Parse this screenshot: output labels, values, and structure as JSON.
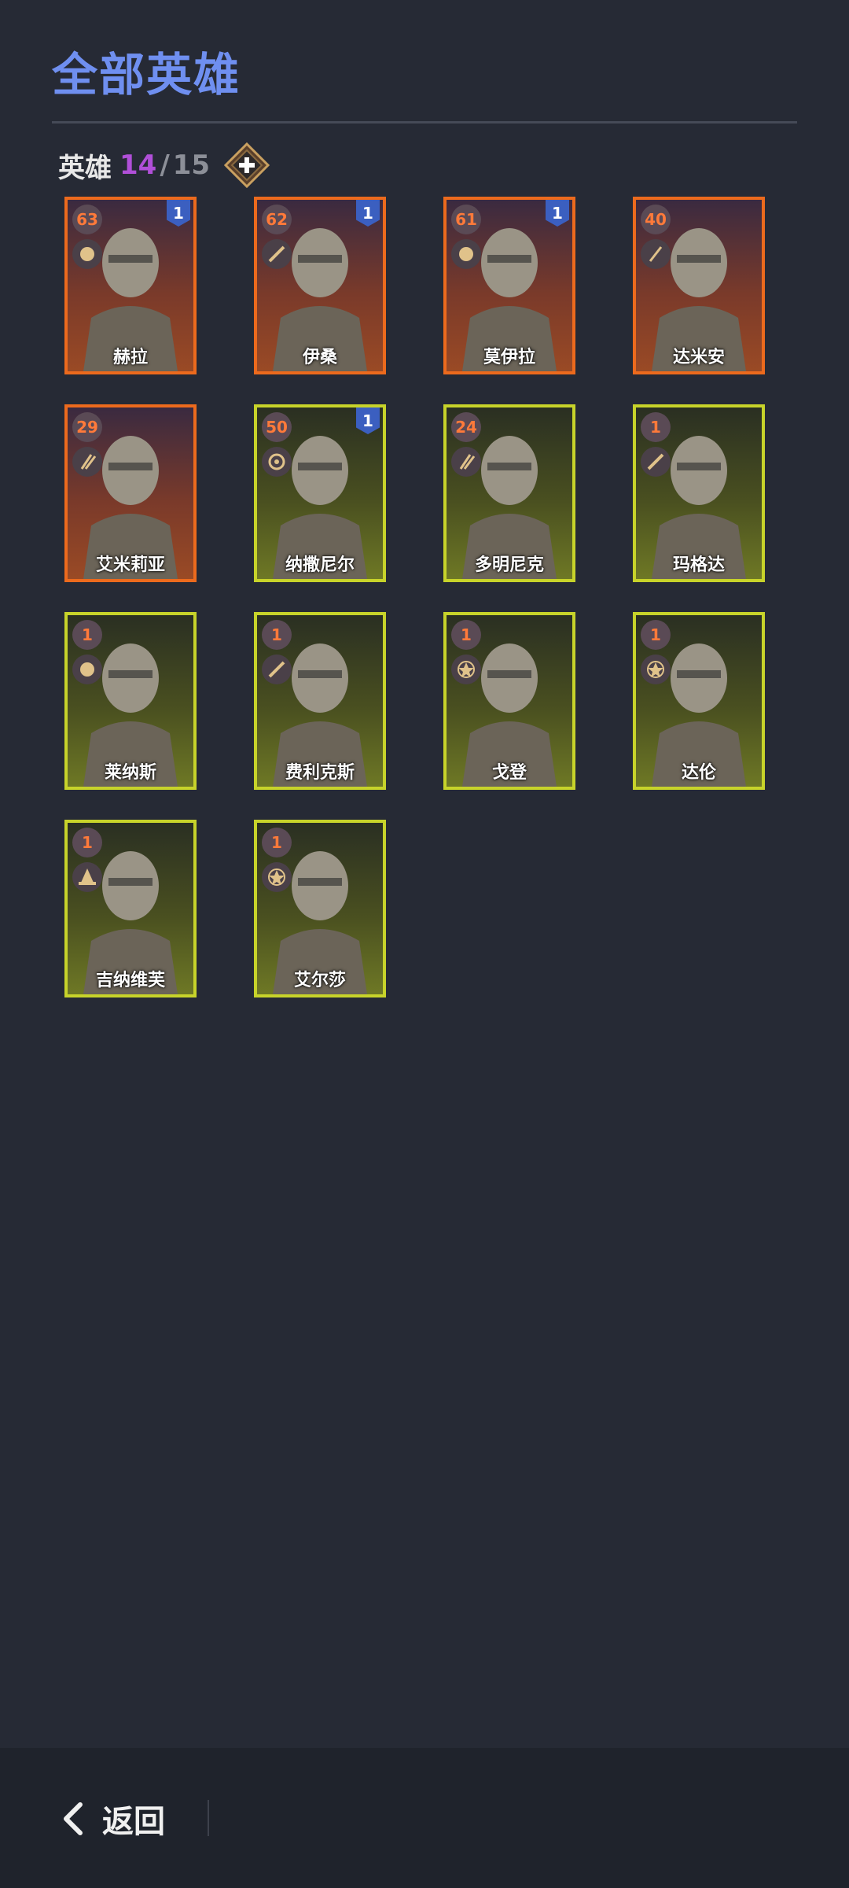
{
  "header": {
    "title": "全部英雄"
  },
  "hero_count": {
    "label": "英雄",
    "owned": "14",
    "separator": "/",
    "total": "15"
  },
  "heroes": [
    {
      "name": "赫拉",
      "level": "63",
      "rank": "1",
      "border": "orange",
      "class_icon": "horse-helm-icon"
    },
    {
      "name": "伊桑",
      "level": "62",
      "rank": "1",
      "border": "orange",
      "class_icon": "sword-icon"
    },
    {
      "name": "莫伊拉",
      "level": "61",
      "rank": "1",
      "border": "orange",
      "class_icon": "horse-helm-icon"
    },
    {
      "name": "达米安",
      "level": "40",
      "rank": "",
      "border": "orange",
      "class_icon": "dagger-icon"
    },
    {
      "name": "艾米莉亚",
      "level": "29",
      "rank": "",
      "border": "orange",
      "class_icon": "arrows-icon"
    },
    {
      "name": "纳撒尼尔",
      "level": "50",
      "rank": "1",
      "border": "yellow",
      "class_icon": "target-icon"
    },
    {
      "name": "多明尼克",
      "level": "24",
      "rank": "",
      "border": "yellow",
      "class_icon": "arrows-icon"
    },
    {
      "name": "玛格达",
      "level": "1",
      "rank": "",
      "border": "yellow",
      "class_icon": "sword-icon"
    },
    {
      "name": "莱纳斯",
      "level": "1",
      "rank": "",
      "border": "yellow",
      "class_icon": "horse-helm-icon"
    },
    {
      "name": "费利克斯",
      "level": "1",
      "rank": "",
      "border": "yellow",
      "class_icon": "sword-icon"
    },
    {
      "name": "戈登",
      "level": "1",
      "rank": "",
      "border": "yellow",
      "class_icon": "pentagram-icon"
    },
    {
      "name": "达伦",
      "level": "1",
      "rank": "",
      "border": "yellow",
      "class_icon": "pentagram-icon"
    },
    {
      "name": "吉纳维芙",
      "level": "1",
      "rank": "",
      "border": "yellow",
      "class_icon": "wizard-hat-icon"
    },
    {
      "name": "艾尔莎",
      "level": "1",
      "rank": "",
      "border": "yellow",
      "class_icon": "pentagram-icon"
    }
  ],
  "footer": {
    "back_label": "返回"
  },
  "colors": {
    "title": "#6f8ff0",
    "orange_border": "#ec6a1d",
    "yellow_border": "#c7d32a",
    "owned": "#b04fd8",
    "background": "#262a35"
  }
}
